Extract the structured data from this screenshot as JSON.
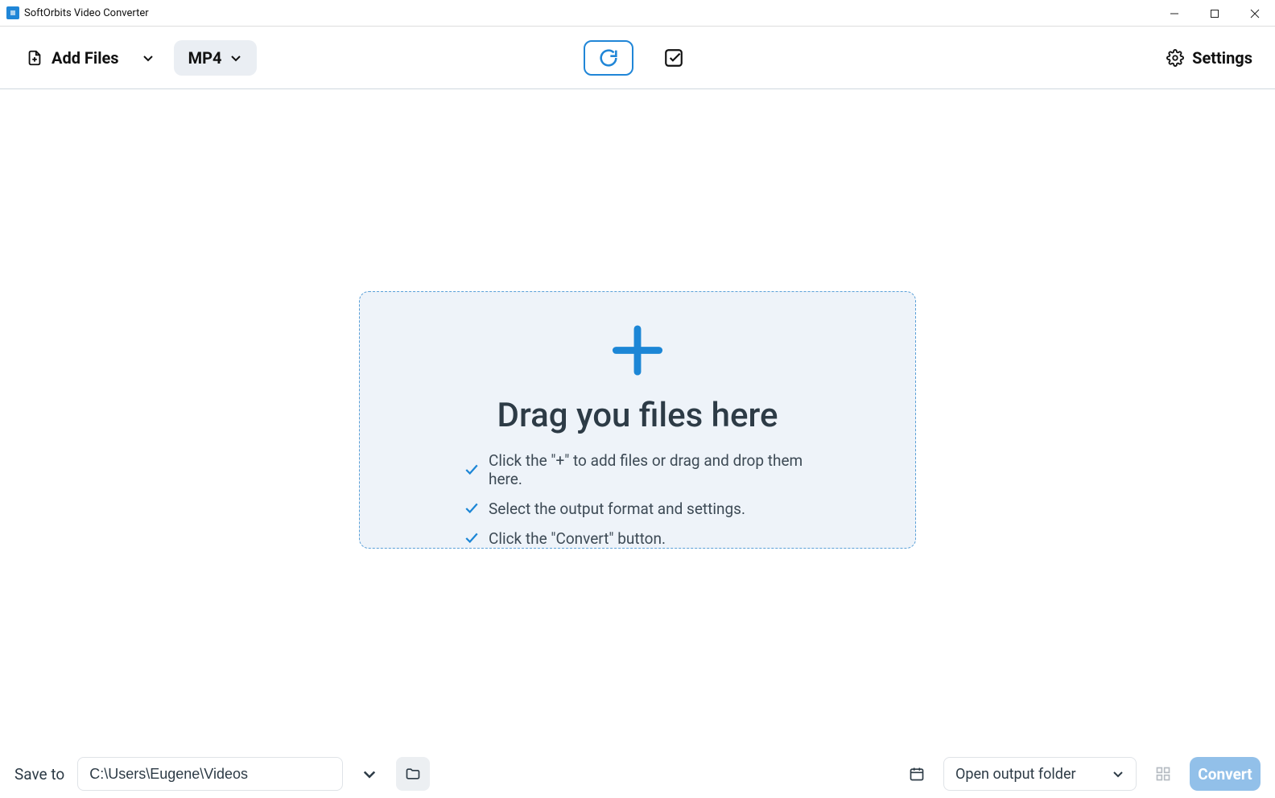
{
  "titlebar": {
    "app_title": "SoftOrbits Video Converter"
  },
  "toolbar": {
    "add_files_label": "Add Files",
    "format_label": "MP4",
    "settings_label": "Settings"
  },
  "dropzone": {
    "heading": "Drag you files here",
    "tips": [
      "Click the \"+\" to add files or drag and drop them here.",
      "Select the output format and settings.",
      "Click the \"Convert\" button."
    ]
  },
  "bottombar": {
    "save_to_label": "Save to",
    "save_path": "C:\\Users\\Eugene\\Videos",
    "open_output_label": "Open output folder",
    "convert_label": "Convert"
  }
}
